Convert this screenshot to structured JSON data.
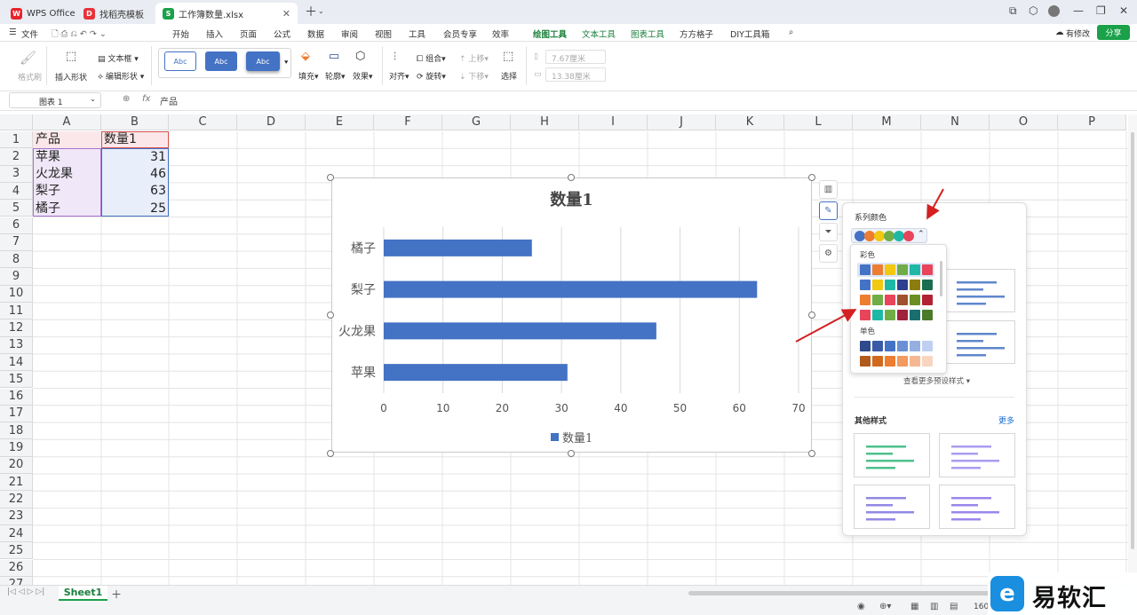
{
  "tabs": [
    {
      "label": "WPS Office",
      "icon": "wps-logo-icon"
    },
    {
      "label": "找稻壳模板",
      "icon": "docer-logo-icon"
    },
    {
      "label": "工作簿数量.xlsx",
      "icon": "spreadsheet-s-icon"
    }
  ],
  "menu": {
    "file": "文件",
    "items": [
      "开始",
      "插入",
      "页面",
      "公式",
      "数据",
      "审阅",
      "视图",
      "工具",
      "会员专享",
      "效率",
      "绘图工具",
      "文本工具",
      "图表工具",
      "方方格子",
      "DIY工具箱"
    ],
    "active": "绘图工具",
    "edit_status": "有修改",
    "share": "分享"
  },
  "ribbon": {
    "format_brush": "格式刷",
    "insert_shape": "插入形状",
    "textbox": "文本框",
    "edit_shape": "编辑形状",
    "style_sample": "Abc",
    "fill": "填充",
    "outline": "轮廓",
    "effect": "效果",
    "align": "对齐",
    "group": "组合",
    "rotate": "旋转",
    "bring_up": "上移",
    "send_down": "下移",
    "select": "选择",
    "height": "7.67厘米",
    "width": "13.38厘米"
  },
  "formula_bar": {
    "name_box": "图表 1",
    "fx": "fx",
    "content": "产品"
  },
  "columns": [
    "A",
    "B",
    "C",
    "D",
    "E",
    "F",
    "G",
    "H",
    "I",
    "J",
    "K",
    "L",
    "M",
    "N",
    "O",
    "P"
  ],
  "rows": [
    "1",
    "2",
    "3",
    "4",
    "5",
    "6",
    "7",
    "8",
    "9",
    "10",
    "11",
    "12",
    "13",
    "14",
    "15",
    "16",
    "17",
    "18",
    "19",
    "20",
    "21",
    "22",
    "23",
    "24",
    "25",
    "26",
    "27"
  ],
  "table": {
    "headers": [
      "产品",
      "数量1"
    ],
    "rows": [
      [
        "苹果",
        "31"
      ],
      [
        "火龙果",
        "46"
      ],
      [
        "梨子",
        "63"
      ],
      [
        "橘子",
        "25"
      ]
    ]
  },
  "chart_data": {
    "type": "bar",
    "orientation": "horizontal",
    "title": "数量1",
    "categories": [
      "苹果",
      "火龙果",
      "梨子",
      "橘子"
    ],
    "series": [
      {
        "name": "数量1",
        "values": [
          31,
          46,
          63,
          25
        ],
        "color": "#4472c4"
      }
    ],
    "xlim": [
      0,
      70
    ],
    "ticks": [
      "0",
      "10",
      "20",
      "30",
      "40",
      "50",
      "60",
      "70"
    ],
    "grid": true,
    "legend": "bottom"
  },
  "panel": {
    "series_color_title": "系列颜色",
    "colorful_label": "彩色",
    "mono_label": "单色",
    "more_presets": "查看更多预设样式",
    "other_styles": "其他样式",
    "more": "更多",
    "selected_palette": [
      "#4472c4",
      "#ed7d31",
      "#f2c811",
      "#70ad47",
      "#1fb8a6",
      "#e8445a"
    ],
    "colorful_palettes": [
      [
        "#4472c4",
        "#ed7d31",
        "#f2c811",
        "#70ad47",
        "#1fb8a6",
        "#e8445a"
      ],
      [
        "#4472c4",
        "#f2c811",
        "#1fb8a6",
        "#2e3f8f",
        "#8b7d10",
        "#1a6e4f"
      ],
      [
        "#ed7d31",
        "#70ad47",
        "#e8445a",
        "#a0522d",
        "#6b8e23",
        "#b22234"
      ],
      [
        "#e8445a",
        "#1fb8a6",
        "#70ad47",
        "#a0223d",
        "#1a6e6e",
        "#4a7a2a"
      ]
    ],
    "mono_palettes": [
      [
        "#2f4a8a",
        "#3a5aa8",
        "#4472c4",
        "#6a8fd4",
        "#95b0e0",
        "#c0cff0"
      ],
      [
        "#b05a1c",
        "#d0691e",
        "#ed7d31",
        "#f29a60",
        "#f5b892",
        "#f9d5c0"
      ]
    ]
  },
  "sheet": {
    "name": "Sheet1",
    "zoom": "160"
  },
  "watermark": "易软汇"
}
